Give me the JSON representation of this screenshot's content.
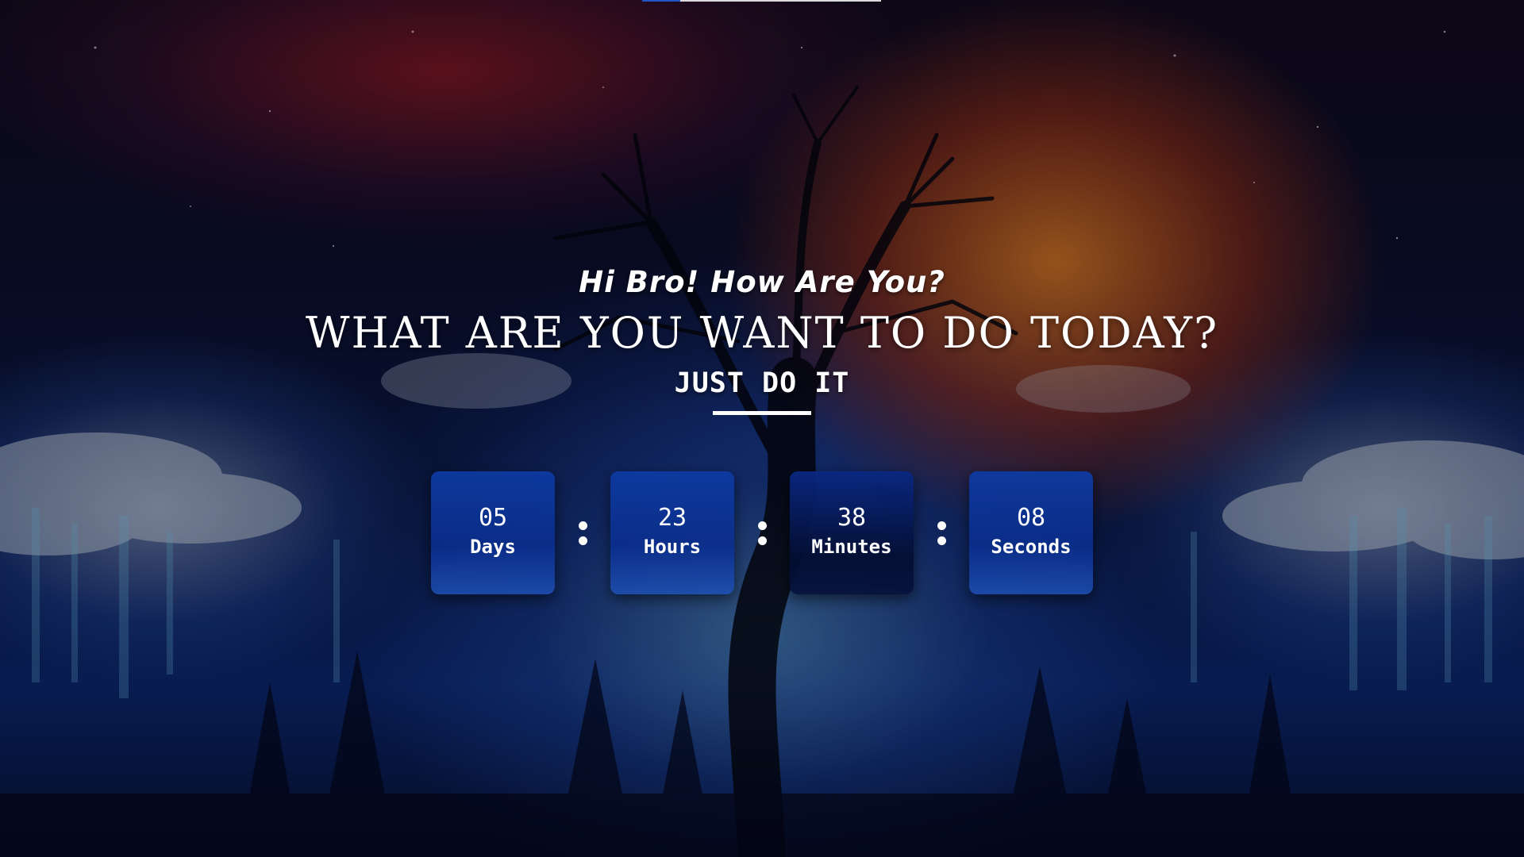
{
  "page": {
    "greeting": "Hi Bro! How Are You?",
    "headline": "WHAT ARE YOU WANT TO DO TODAY?",
    "tagline": "JUST DO IT"
  },
  "top_progress": {
    "fraction": 0.16,
    "fill_color": "#1e56c8",
    "track_color": "#ffffff"
  },
  "countdown": {
    "days": {
      "value": "05",
      "label": "Days"
    },
    "hours": {
      "value": "23",
      "label": "Hours"
    },
    "minutes": {
      "value": "38",
      "label": "Minutes"
    },
    "seconds": {
      "value": "08",
      "label": "Seconds"
    },
    "separator_icon": "colon-dots-icon",
    "card_color": "#0e3aa0"
  },
  "background": {
    "description_icon": "night-sky-tree-background",
    "accent_orange": "#ff8c28",
    "accent_blue": "#0d2a78"
  }
}
